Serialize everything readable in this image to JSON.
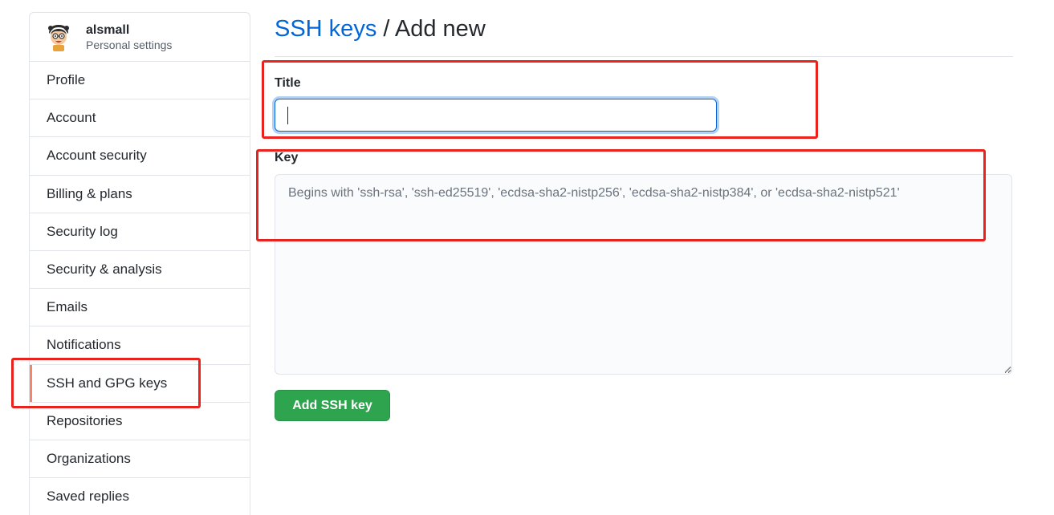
{
  "user": {
    "name": "alsmall",
    "subtitle": "Personal settings"
  },
  "sidebar": {
    "items": [
      {
        "label": "Profile",
        "selected": false
      },
      {
        "label": "Account",
        "selected": false
      },
      {
        "label": "Account security",
        "selected": false
      },
      {
        "label": "Billing & plans",
        "selected": false
      },
      {
        "label": "Security log",
        "selected": false
      },
      {
        "label": "Security & analysis",
        "selected": false
      },
      {
        "label": "Emails",
        "selected": false
      },
      {
        "label": "Notifications",
        "selected": false
      },
      {
        "label": "SSH and GPG keys",
        "selected": true
      },
      {
        "label": "Repositories",
        "selected": false
      },
      {
        "label": "Organizations",
        "selected": false
      },
      {
        "label": "Saved replies",
        "selected": false
      }
    ]
  },
  "header": {
    "breadcrumb_link": "SSH keys",
    "breadcrumb_current": " / Add new"
  },
  "form": {
    "title_label": "Title",
    "title_value": "",
    "key_label": "Key",
    "key_value": "",
    "key_placeholder": "Begins with 'ssh-rsa', 'ssh-ed25519', 'ecdsa-sha2-nistp256', 'ecdsa-sha2-nistp384', or 'ecdsa-sha2-nistp521'",
    "submit_label": "Add SSH key"
  },
  "colors": {
    "link": "#0366d6",
    "primary_button": "#2ea44f",
    "selected_indicator": "#f9826c",
    "annotation": "#e8231e"
  }
}
